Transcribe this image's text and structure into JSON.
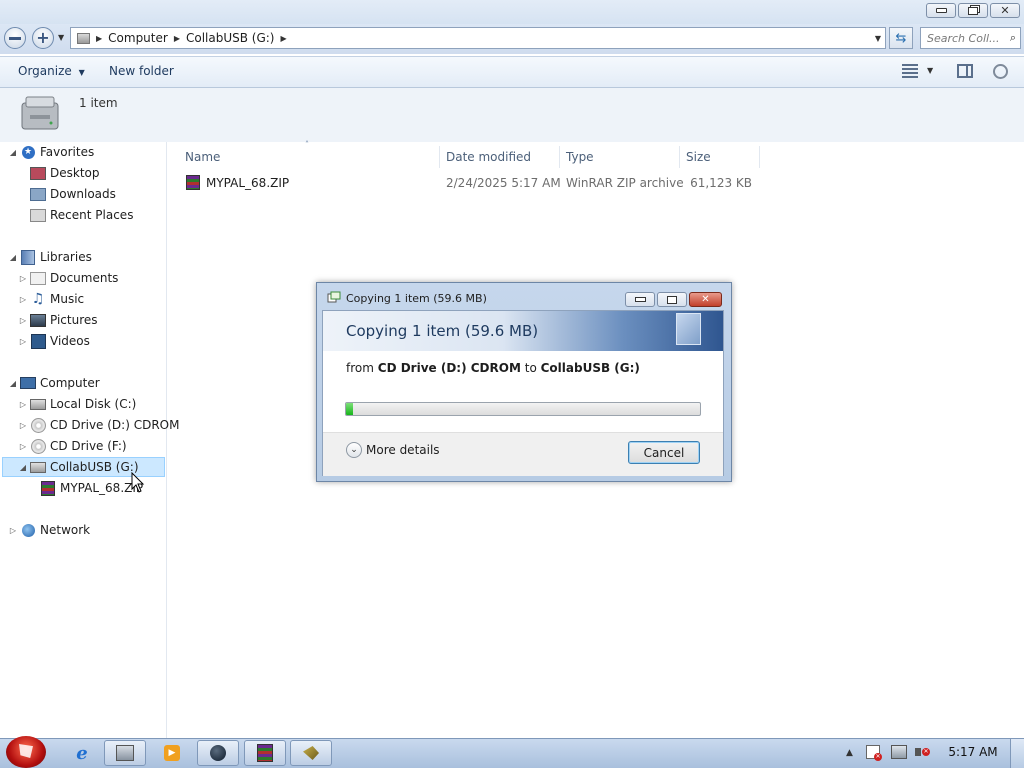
{
  "window": {
    "caption_buttons": {
      "minimize": "minimize-icon",
      "restore": "restore-icon",
      "close": "close-icon"
    }
  },
  "address": {
    "crumbs": [
      "Computer",
      "CollabUSB (G:)"
    ],
    "search_placeholder": "Search Coll..."
  },
  "toolbar": {
    "organize": "Organize",
    "new_folder": "New folder"
  },
  "details": {
    "item_count": "1 item"
  },
  "nav": {
    "favorites": {
      "label": "Favorites",
      "items": [
        "Desktop",
        "Downloads",
        "Recent Places"
      ]
    },
    "libraries": {
      "label": "Libraries",
      "items": [
        "Documents",
        "Music",
        "Pictures",
        "Videos"
      ]
    },
    "computer": {
      "label": "Computer",
      "items": [
        "Local Disk (C:)",
        "CD Drive (D:) CDROM",
        "CD Drive (F:)",
        "CollabUSB (G:)"
      ],
      "child": "MYPAL_68.ZIP"
    },
    "network": {
      "label": "Network"
    }
  },
  "filelist": {
    "columns": [
      "Name",
      "Date modified",
      "Type",
      "Size"
    ],
    "rows": [
      {
        "name": "MYPAL_68.ZIP",
        "date": "2/24/2025 5:17 AM",
        "type": "WinRAR ZIP archive",
        "size": "61,123 KB"
      }
    ]
  },
  "dialog": {
    "title": "Copying 1 item (59.6 MB)",
    "heading": "Copying 1 item (59.6 MB)",
    "from_prefix": "from",
    "source": "CD Drive (D:) CDROM",
    "to_word": "to",
    "destination": "CollabUSB (G:)",
    "progress": 0.02,
    "more_details": "More details",
    "cancel": "Cancel"
  },
  "taskbar": {
    "apps": [
      "internet-explorer-icon",
      "explorer-icon",
      "media-player-icon",
      "mypal-icon",
      "winrar-icon",
      "app-icon"
    ],
    "clock": "5:17 AM"
  },
  "colors": {
    "accent": "#3c7fb1",
    "progress": "#17b51a",
    "selection": "#cce8ff"
  }
}
